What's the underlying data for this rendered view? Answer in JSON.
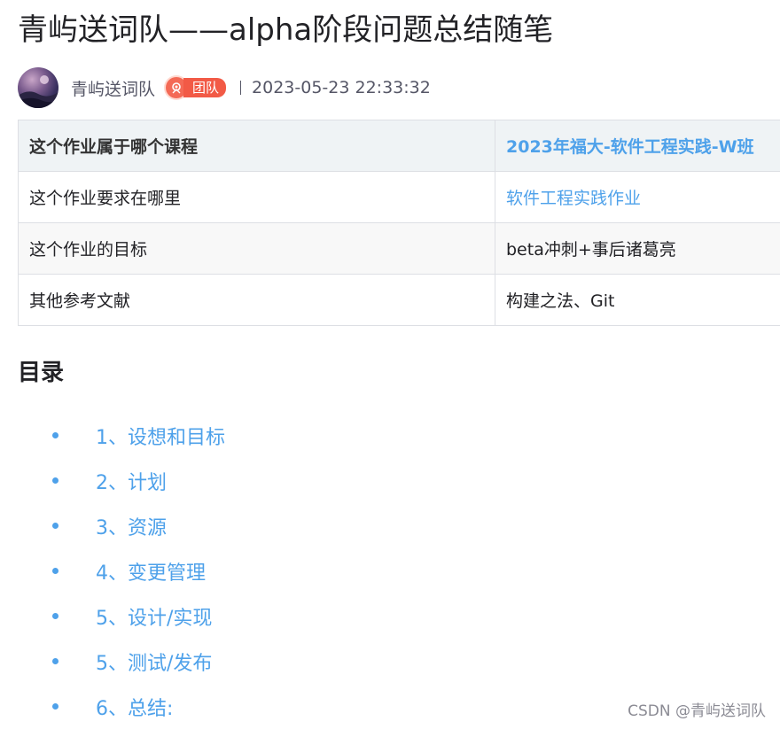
{
  "article": {
    "title": "青屿送词队——alpha阶段问题总结随笔"
  },
  "author": {
    "name": "青屿送词队",
    "badge": "团队",
    "date": "2023-05-23 22:33:32"
  },
  "meta_table": {
    "rows": [
      {
        "label": "这个作业属于哪个课程",
        "value": "2023年福大-软件工程实践-W班",
        "link": true
      },
      {
        "label": "这个作业要求在哪里",
        "value": "软件工程实践作业",
        "link": true
      },
      {
        "label": "这个作业的目标",
        "value": "beta冲刺+事后诸葛亮",
        "link": false
      },
      {
        "label": "其他参考文献",
        "value": "构建之法、Git",
        "link": false
      }
    ]
  },
  "toc": {
    "title": "目录",
    "items": [
      "1、设想和目标",
      "2、计划",
      "3、资源",
      "4、变更管理",
      "5、设计/实现",
      "5、测试/发布",
      "6、总结:"
    ]
  },
  "watermark": "CSDN @青屿送词队",
  "colors": {
    "link": "#4ea1ea",
    "badge": "#f25a46",
    "table_header_bg": "#eff3f5",
    "text": "#222226",
    "muted": "#555666"
  },
  "icons": {
    "badge_icon": "team-rose-icon"
  }
}
